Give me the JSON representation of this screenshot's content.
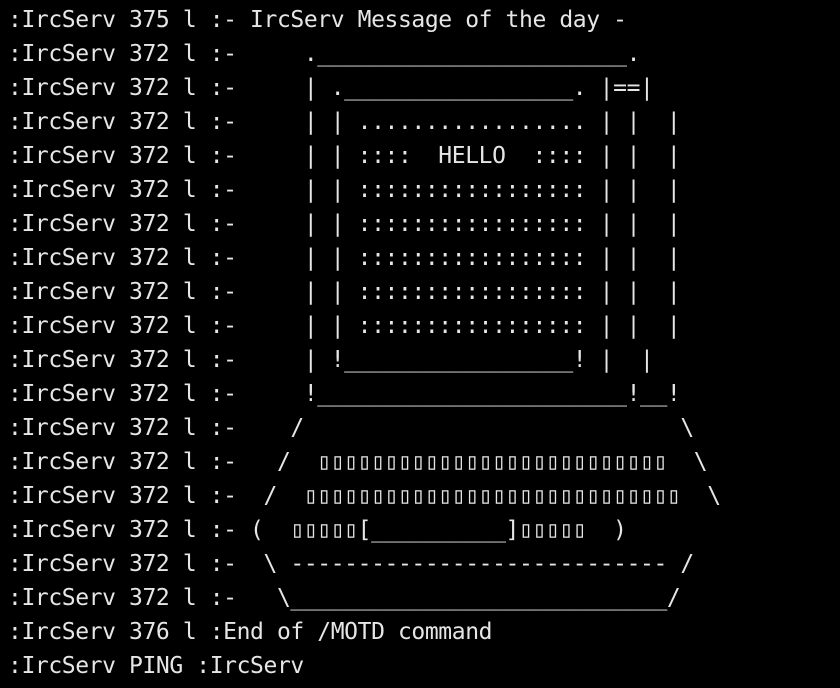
{
  "terminal": {
    "lines": [
      ":IrcServ 375 l :- IrcServ Message of the day -",
      ":IrcServ 372 l :-     ._______________________.",
      ":IrcServ 372 l :-     | ._________________. |==|",
      ":IrcServ 372 l :-     | | ................. | |  |",
      ":IrcServ 372 l :-     | | ::::  HELLO  :::: | |  |",
      ":IrcServ 372 l :-     | | ::::::::::::::::: | |  |",
      ":IrcServ 372 l :-     | | ::::::::::::::::: | |  |",
      ":IrcServ 372 l :-     | | ::::::::::::::::: | |  |",
      ":IrcServ 372 l :-     | | ::::::::::::::::: | |  |",
      ":IrcServ 372 l :-     | | ::::::::::::::::: | |  |",
      ":IrcServ 372 l :-     | !_________________! |  |",
      ":IrcServ 372 l :-     !_______________________!__!",
      ":IrcServ 372 l :-    /                            \\",
      ":IrcServ 372 l :-   /  ▯▯▯▯▯▯▯▯▯▯▯▯▯▯▯▯▯▯▯▯▯▯▯▯▯▯  \\",
      ":IrcServ 372 l :-  /  ▯▯▯▯▯▯▯▯▯▯▯▯▯▯▯▯▯▯▯▯▯▯▯▯▯▯▯▯  \\",
      ":IrcServ 372 l :- (  ▯▯▯▯▯[__________]▯▯▯▯▯  )",
      ":IrcServ 372 l :-  \\ ---------------------------- /",
      ":IrcServ 372 l :-   \\____________________________/",
      ":IrcServ 376 l :End of /MOTD command",
      ":IrcServ PING :IrcServ"
    ]
  }
}
